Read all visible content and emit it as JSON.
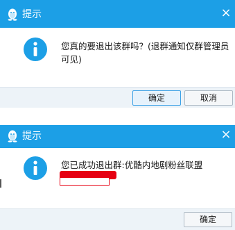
{
  "dialog_quit_confirm": {
    "title": "提示",
    "close_symbol": "×",
    "message": "您真的要退出该群吗？(退群通知仅群管理员可见)",
    "buttons": {
      "ok": "确定",
      "cancel": "取消"
    },
    "icons": {
      "app": "qq-penguin-icon",
      "info": "info-icon",
      "close": "close-icon"
    }
  },
  "dialog_quit_success": {
    "title": "提示",
    "close_symbol": "×",
    "message": "您已成功退出群:优酷内地剧粉丝联盟",
    "buttons": {
      "ok": "确定"
    },
    "icons": {
      "app": "qq-penguin-icon",
      "info": "info-icon",
      "close": "close-icon"
    }
  },
  "colors": {
    "titlebar": "#1c9fe6",
    "info_icon": "#1c9fe6",
    "footer": "#edf3f8",
    "redaction": "#e60012"
  }
}
